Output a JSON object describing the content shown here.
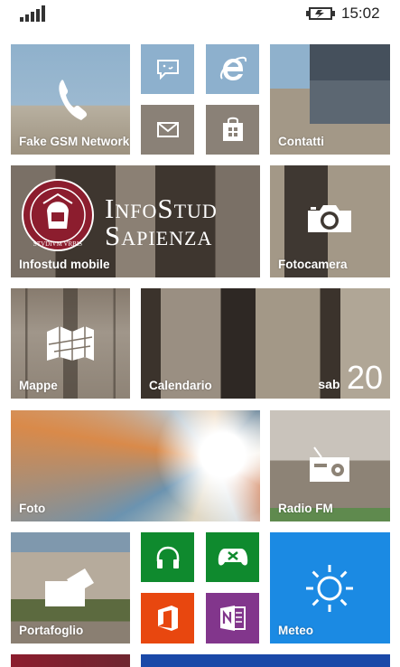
{
  "status_bar": {
    "time": "15:02",
    "signal_icon": "signal-bars-icon",
    "battery_icon": "battery-charging-icon"
  },
  "colors": {
    "green": "#0f8a2e",
    "orange": "#e8470f",
    "purple": "#82368c",
    "blue": "#1b8ae3",
    "navy": "#1a49a8"
  },
  "tiles": {
    "phone": {
      "label": "Fake GSM Network",
      "icon": "phone-icon"
    },
    "messaging": {
      "icon": "messaging-icon"
    },
    "ie": {
      "icon": "internet-explorer-icon"
    },
    "mail": {
      "icon": "mail-icon"
    },
    "store": {
      "icon": "store-icon"
    },
    "contacts": {
      "label": "Contatti"
    },
    "infostud": {
      "label": "Infostud mobile",
      "logo_line1": "InfoStud",
      "logo_line2": "Sapienza",
      "seal_text": "STVDIVM VRBIS",
      "icon": "sapienza-seal-icon"
    },
    "camera": {
      "label": "Fotocamera",
      "icon": "camera-icon"
    },
    "maps": {
      "label": "Mappe",
      "icon": "map-icon"
    },
    "calendar": {
      "label": "Calendario",
      "day_name": "sab",
      "day_number": "20"
    },
    "photos": {
      "label": "Foto"
    },
    "radio": {
      "label": "Radio FM",
      "icon": "radio-icon"
    },
    "wallet": {
      "label": "Portafoglio",
      "icon": "wallet-icon"
    },
    "music": {
      "icon": "headphones-icon"
    },
    "games": {
      "icon": "xbox-icon"
    },
    "office": {
      "icon": "office-icon"
    },
    "onenote": {
      "icon": "onenote-icon"
    },
    "weather": {
      "label": "Meteo",
      "icon": "sun-icon"
    }
  }
}
